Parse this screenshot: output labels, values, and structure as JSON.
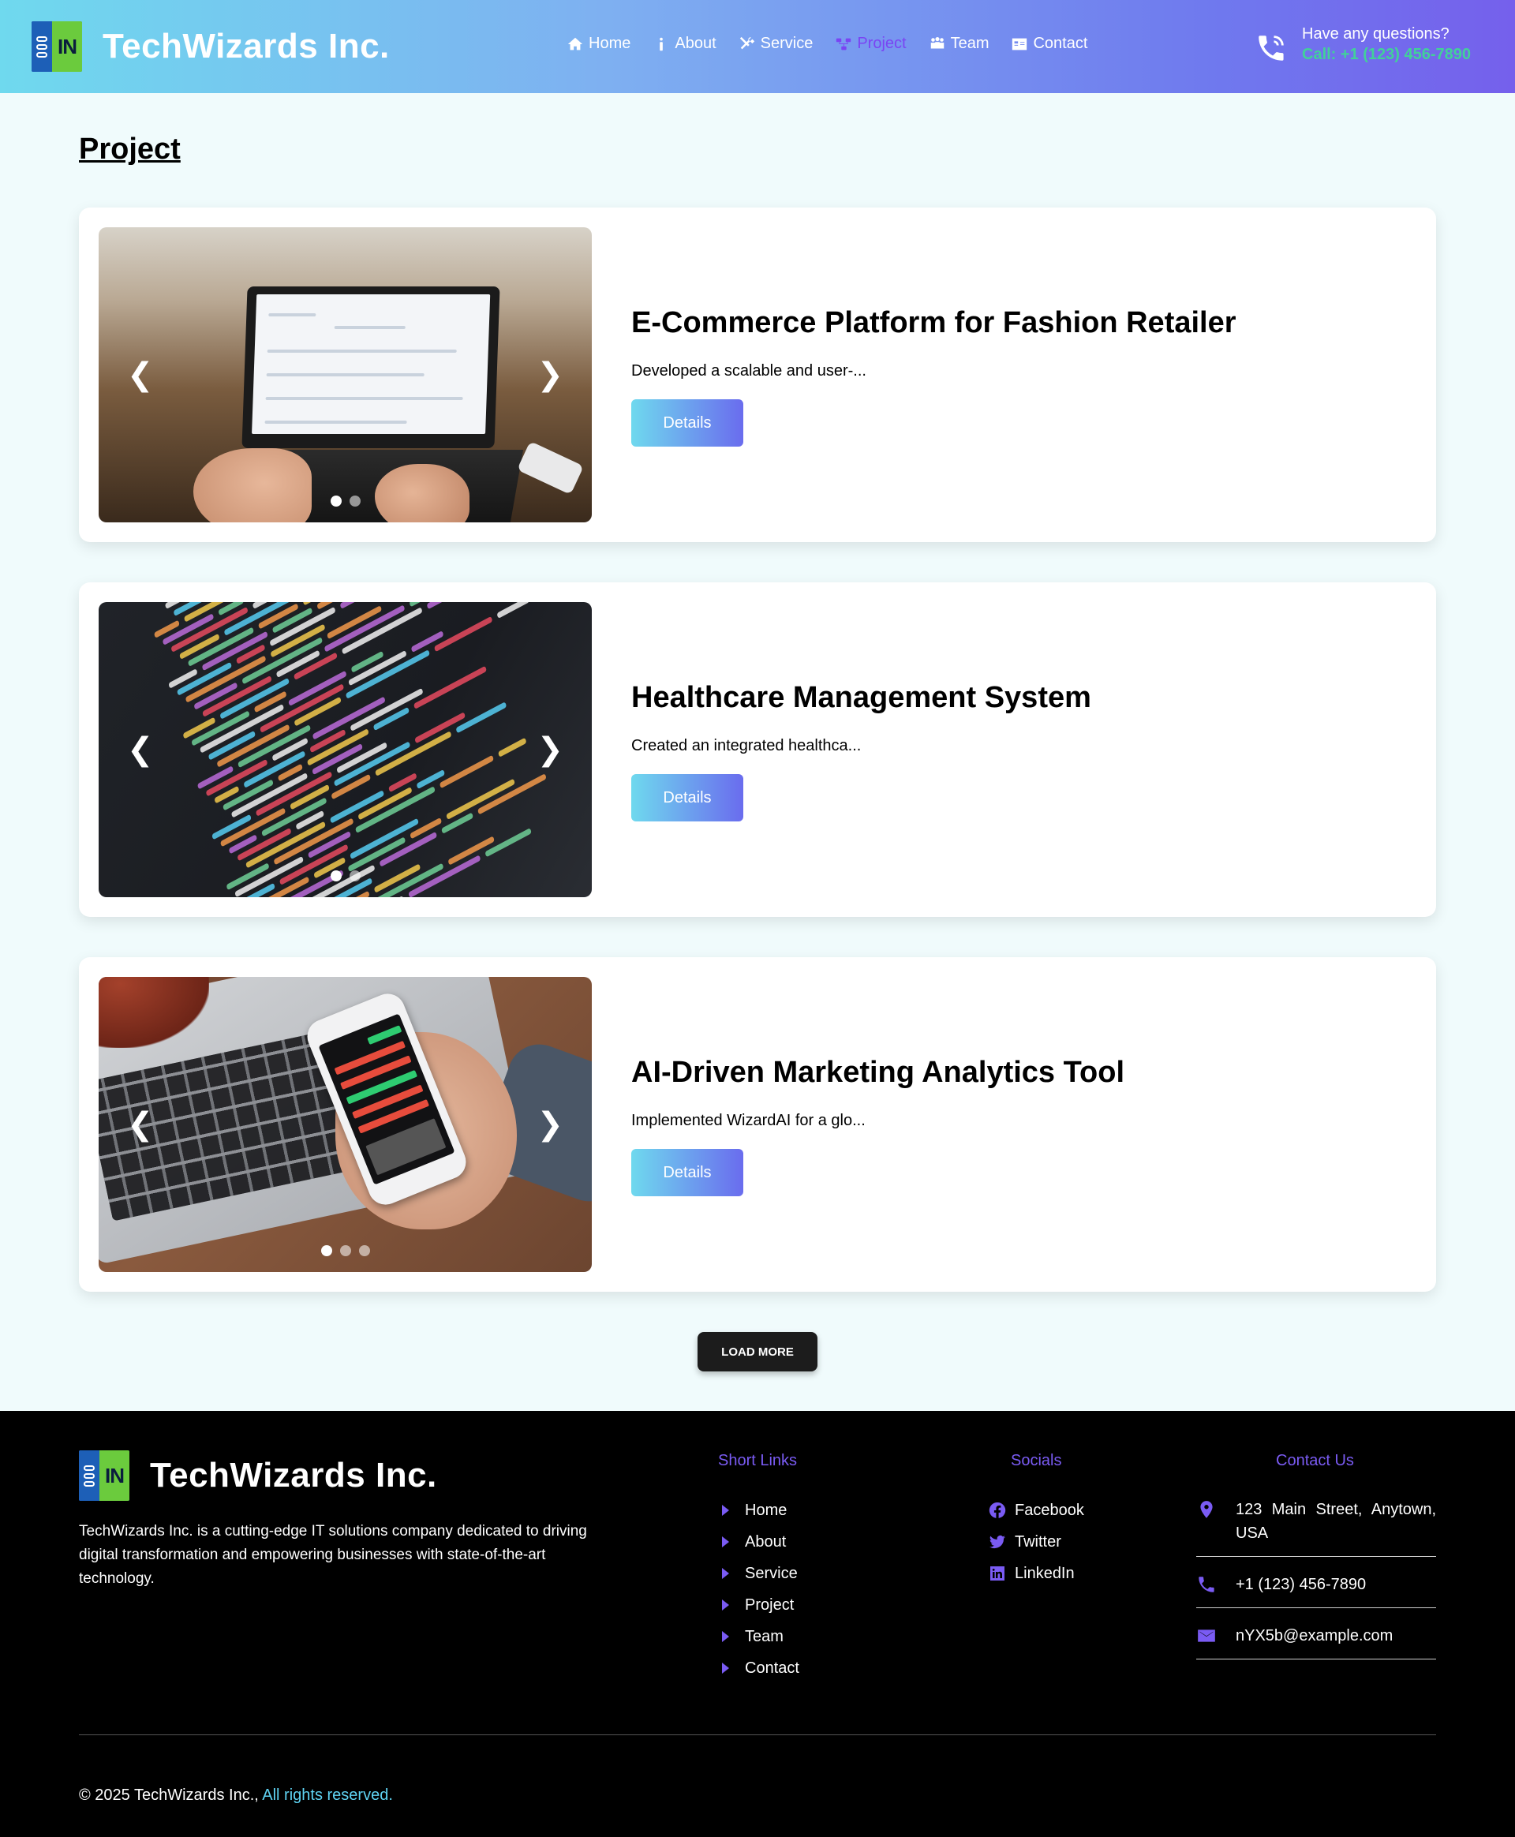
{
  "header": {
    "brand": {
      "logo_text": "IN",
      "name": "TechWizards Inc."
    },
    "nav": [
      {
        "label": "Home",
        "icon": "home-icon",
        "active": false
      },
      {
        "label": "About",
        "icon": "info-icon",
        "active": false
      },
      {
        "label": "Service",
        "icon": "tools-icon",
        "active": false
      },
      {
        "label": "Project",
        "icon": "project-icon",
        "active": true
      },
      {
        "label": "Team",
        "icon": "team-icon",
        "active": false
      },
      {
        "label": "Contact",
        "icon": "contact-card-icon",
        "active": false
      }
    ],
    "contact": {
      "question": "Have any questions?",
      "call": "Call: +1 (123) 456-7890",
      "icon": "phone-call-icon"
    }
  },
  "main": {
    "title": "Project",
    "projects": [
      {
        "title": "E-Commerce Platform for Fashion Retailer",
        "summary": "Developed a scalable and user-...",
        "button": "Details",
        "slides": 2,
        "active_slide": 1
      },
      {
        "title": "Healthcare Management System",
        "summary": "Created an integrated healthca...",
        "button": "Details",
        "slides": 2,
        "active_slide": 1
      },
      {
        "title": "AI-Driven Marketing Analytics Tool",
        "summary": "Implemented WizardAI for a glo...",
        "button": "Details",
        "slides": 3,
        "active_slide": 1
      }
    ],
    "load_more": "LOAD MORE"
  },
  "footer": {
    "brand": {
      "logo_text": "IN",
      "name": "TechWizards Inc."
    },
    "about": "TechWizards Inc. is a cutting-edge IT solutions company dedicated to driving digital transformation and empowering businesses with state-of-the-art technology.",
    "short_links": {
      "title": "Short Links",
      "items": [
        "Home",
        "About",
        "Service",
        "Project",
        "Team",
        "Contact"
      ]
    },
    "socials": {
      "title": "Socials",
      "items": [
        {
          "label": "Facebook",
          "icon": "facebook-icon"
        },
        {
          "label": "Twitter",
          "icon": "twitter-icon"
        },
        {
          "label": "LinkedIn",
          "icon": "linkedin-icon"
        }
      ]
    },
    "contact": {
      "title": "Contact Us",
      "address": "123 Main Street, Anytown, USA",
      "phone": "+1 (123) 456-7890",
      "email": "nYX5b@example.com"
    },
    "copyright": "© 2025 TechWizards Inc.,",
    "rights": "All rights reserved."
  },
  "colors": {
    "accent": "#7a5bf3",
    "call_green": "#41d199",
    "gradient_start": "#6fd9ee",
    "gradient_end": "#7560ec"
  }
}
